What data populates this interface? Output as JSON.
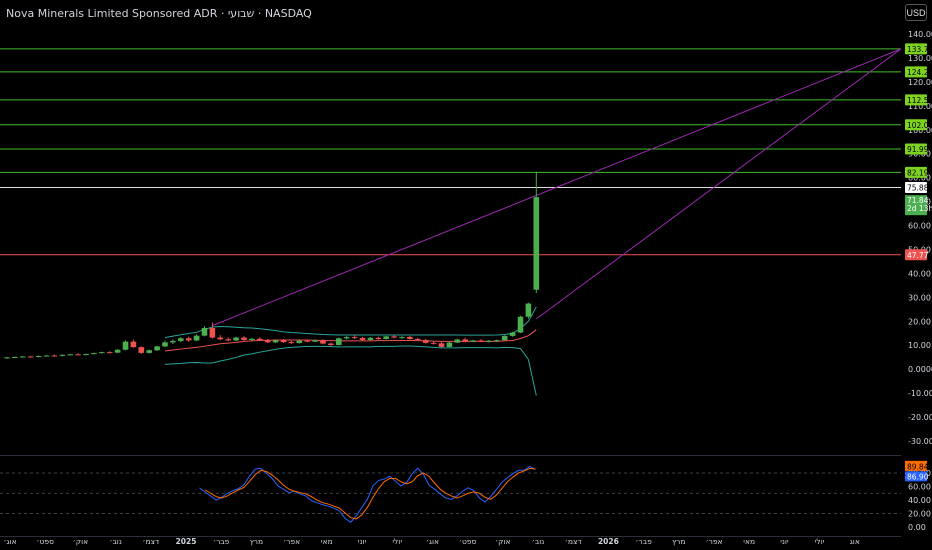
{
  "title": "Nova Minerals Limited Sponsored ADR · שבועי · NASDAQ",
  "currency_button": "USD",
  "colors": {
    "background": "#000000",
    "up": "#4caf50",
    "down": "#ef5350",
    "level_line": "#3fbf2a",
    "level_badge": "#7ed321",
    "red_level": "#ef5350",
    "trendline": "#9c27b0",
    "bb_band": "#26a69a",
    "bb_basis": "#ef5350",
    "stoch_k": "#2962ff",
    "stoch_d": "#ff6d00",
    "grid_text": "#d1d4dc"
  },
  "price_axis": {
    "ticks": [
      "140.00",
      "130.00",
      "120.00",
      "110.00",
      "100.00",
      "90.00",
      "80.00",
      "70.00",
      "60.00",
      "50.00",
      "40.00",
      "30.00",
      "20.00",
      "10.00",
      "0.0000",
      "-10.00",
      "-20.00",
      "-30.00"
    ],
    "tick_values": [
      140,
      130,
      120,
      110,
      100,
      90,
      80,
      70,
      60,
      50,
      40,
      30,
      20,
      10,
      0,
      -10,
      -20,
      -30
    ],
    "ylim": [
      -35,
      146
    ]
  },
  "levels": [
    {
      "label": "133.79",
      "value": 133.79,
      "color": "green"
    },
    {
      "label": "124.20",
      "value": 124.2,
      "color": "green"
    },
    {
      "label": "112.51",
      "value": 112.51,
      "color": "green"
    },
    {
      "label": "102.09",
      "value": 102.09,
      "color": "green"
    },
    {
      "label": "91.99",
      "value": 91.99,
      "color": "green"
    },
    {
      "label": "82.19",
      "value": 82.19,
      "color": "green"
    },
    {
      "label": "75.88",
      "value": 75.88,
      "color": "white"
    },
    {
      "label": "47.77",
      "value": 47.77,
      "color": "red"
    }
  ],
  "last_price": {
    "label": "71.84",
    "countdown": "2d 13h",
    "value": 71.84
  },
  "stoch_axis": {
    "ticks": [
      "80.00",
      "60.00",
      "40.00",
      "20.00",
      "0.00"
    ],
    "tick_values": [
      80,
      60,
      40,
      20,
      0
    ],
    "ylim": [
      -4,
      98
    ],
    "k_label": "89.84",
    "d_label": "86.90"
  },
  "time_axis": [
    "אוג׳",
    "ספט׳",
    "אוק׳",
    "נוב׳",
    "דצמ׳",
    "2025",
    "פבר׳",
    "מרץ",
    "אפר׳",
    "מאי",
    "יוני",
    "יולי",
    "אוג׳",
    "ספט׳",
    "אוק׳",
    "נוב׳",
    "דצמ׳",
    "2026",
    "פבר׳",
    "מרץ",
    "אפר׳",
    "מאי",
    "יוני",
    "יולי",
    "אוג"
  ],
  "chart_data": {
    "type": "candlestick",
    "interval": "weekly",
    "candles": [
      [
        4.6,
        5.1,
        4.4,
        4.9
      ],
      [
        4.9,
        5.3,
        4.7,
        5.1
      ],
      [
        5.1,
        5.5,
        4.9,
        5.3
      ],
      [
        5.3,
        5.6,
        5.0,
        5.2
      ],
      [
        5.2,
        5.7,
        5.0,
        5.5
      ],
      [
        5.5,
        5.9,
        5.3,
        5.7
      ],
      [
        5.7,
        6.1,
        5.4,
        5.6
      ],
      [
        5.6,
        6.2,
        5.4,
        6.0
      ],
      [
        6.0,
        6.4,
        5.8,
        6.2
      ],
      [
        6.2,
        6.6,
        5.7,
        5.9
      ],
      [
        5.9,
        6.5,
        5.7,
        6.3
      ],
      [
        6.3,
        6.9,
        6.1,
        6.7
      ],
      [
        6.7,
        7.3,
        6.5,
        7.1
      ],
      [
        7.1,
        7.5,
        6.6,
        6.9
      ],
      [
        6.9,
        8.4,
        6.7,
        8.1
      ],
      [
        8.1,
        12.0,
        7.9,
        11.5
      ],
      [
        11.5,
        12.4,
        8.9,
        9.2
      ],
      [
        9.2,
        9.6,
        6.4,
        6.8
      ],
      [
        6.8,
        8.2,
        6.5,
        7.9
      ],
      [
        7.9,
        9.8,
        7.6,
        9.5
      ],
      [
        9.5,
        11.8,
        9.2,
        11.2
      ],
      [
        11.2,
        12.4,
        10.5,
        11.8
      ],
      [
        11.8,
        13.4,
        11.3,
        12.9
      ],
      [
        12.9,
        13.6,
        11.4,
        12.0
      ],
      [
        12.0,
        14.5,
        11.7,
        14.0
      ],
      [
        14.0,
        18.0,
        13.7,
        17.2
      ],
      [
        17.2,
        19.5,
        12.8,
        13.2
      ],
      [
        13.2,
        14.2,
        12.0,
        12.5
      ],
      [
        12.5,
        13.3,
        11.7,
        12.0
      ],
      [
        12.0,
        13.6,
        11.7,
        13.2
      ],
      [
        13.2,
        13.8,
        11.9,
        12.2
      ],
      [
        12.2,
        13.1,
        11.6,
        12.7
      ],
      [
        12.7,
        13.3,
        11.8,
        12.1
      ],
      [
        12.1,
        12.6,
        10.9,
        11.2
      ],
      [
        11.2,
        12.4,
        10.9,
        12.0
      ],
      [
        12.0,
        12.6,
        11.0,
        11.3
      ],
      [
        11.3,
        11.9,
        10.6,
        10.9
      ],
      [
        10.9,
        12.2,
        10.7,
        11.9
      ],
      [
        11.9,
        12.3,
        11.2,
        11.5
      ],
      [
        11.5,
        12.4,
        11.3,
        12.1
      ],
      [
        12.1,
        12.5,
        10.4,
        10.7
      ],
      [
        10.7,
        11.2,
        9.8,
        10.1
      ],
      [
        10.1,
        13.2,
        9.9,
        12.9
      ],
      [
        12.9,
        13.8,
        12.4,
        13.4
      ],
      [
        13.4,
        14.2,
        12.6,
        13.0
      ],
      [
        13.0,
        13.5,
        11.9,
        12.2
      ],
      [
        12.2,
        13.4,
        11.9,
        13.1
      ],
      [
        13.1,
        13.5,
        12.3,
        12.6
      ],
      [
        12.6,
        13.9,
        12.4,
        13.7
      ],
      [
        13.7,
        14.3,
        12.9,
        13.2
      ],
      [
        13.2,
        13.7,
        12.6,
        13.5
      ],
      [
        13.5,
        13.9,
        12.3,
        12.6
      ],
      [
        12.6,
        13.1,
        11.9,
        12.2
      ],
      [
        12.2,
        12.6,
        10.7,
        11.0
      ],
      [
        11.0,
        11.6,
        10.3,
        10.8
      ],
      [
        10.8,
        11.4,
        9.0,
        9.3
      ],
      [
        9.3,
        11.4,
        9.1,
        11.1
      ],
      [
        11.1,
        12.7,
        10.9,
        12.4
      ],
      [
        12.4,
        13.2,
        11.2,
        11.5
      ],
      [
        11.5,
        12.3,
        11.3,
        12.0
      ],
      [
        12.0,
        12.5,
        11.3,
        11.6
      ],
      [
        11.6,
        12.2,
        11.1,
        11.9
      ],
      [
        11.9,
        12.4,
        11.4,
        12.1
      ],
      [
        12.1,
        14.2,
        11.9,
        13.9
      ],
      [
        13.9,
        15.6,
        13.6,
        15.3
      ],
      [
        15.3,
        22.3,
        15.1,
        21.9
      ],
      [
        21.9,
        27.8,
        21.1,
        27.4
      ],
      [
        33.2,
        82.5,
        31.8,
        71.84
      ]
    ],
    "bollinger": {
      "upper": [
        null,
        null,
        null,
        null,
        null,
        null,
        null,
        null,
        null,
        null,
        null,
        null,
        null,
        null,
        null,
        null,
        null,
        null,
        null,
        null,
        13.2,
        13.8,
        14.4,
        14.9,
        15.4,
        16.6,
        17.6,
        17.8,
        17.7,
        17.5,
        17.3,
        17.2,
        16.9,
        16.5,
        16.1,
        15.6,
        15.3,
        15.1,
        14.9,
        14.7,
        14.5,
        14.4,
        14.3,
        14.3,
        14.3,
        14.3,
        14.3,
        14.3,
        14.3,
        14.3,
        14.3,
        14.3,
        14.3,
        14.3,
        14.3,
        14.3,
        14.3,
        14.3,
        14.2,
        14.2,
        14.2,
        14.2,
        14.3,
        14.5,
        15.0,
        17.0,
        20.0,
        26.0
      ],
      "basis": [
        null,
        null,
        null,
        null,
        null,
        null,
        null,
        null,
        null,
        null,
        null,
        null,
        null,
        null,
        null,
        null,
        null,
        null,
        null,
        null,
        7.6,
        8.0,
        8.4,
        8.8,
        9.1,
        9.6,
        10.1,
        10.6,
        10.9,
        11.2,
        11.6,
        11.8,
        12.0,
        12.1,
        12.2,
        12.2,
        12.2,
        12.2,
        12.2,
        12.1,
        12.0,
        11.9,
        11.8,
        11.8,
        11.8,
        11.8,
        11.8,
        11.9,
        11.9,
        11.9,
        12.0,
        12.0,
        11.9,
        11.8,
        11.7,
        11.6,
        11.6,
        11.6,
        11.6,
        11.6,
        11.6,
        11.6,
        11.6,
        11.8,
        12.0,
        12.8,
        14.0,
        16.5
      ],
      "lower": [
        null,
        null,
        null,
        null,
        null,
        null,
        null,
        null,
        null,
        null,
        null,
        null,
        null,
        null,
        null,
        null,
        null,
        null,
        null,
        null,
        2.0,
        2.2,
        2.4,
        2.7,
        2.8,
        2.6,
        2.6,
        3.4,
        4.1,
        4.9,
        5.9,
        6.4,
        7.1,
        7.7,
        8.3,
        8.8,
        9.1,
        9.3,
        9.5,
        9.5,
        9.5,
        9.4,
        9.3,
        9.3,
        9.3,
        9.3,
        9.3,
        9.5,
        9.5,
        9.5,
        9.7,
        9.7,
        9.5,
        9.3,
        9.1,
        8.9,
        8.9,
        8.9,
        9.0,
        9.0,
        9.0,
        9.0,
        8.9,
        9.1,
        9.0,
        8.6,
        4.0,
        -11.0
      ]
    },
    "trendlines": [
      {
        "from": [
          26,
          18.2
        ],
        "to": [
          "extends",
          133.79
        ]
      },
      {
        "from": [
          67,
          21.0
        ],
        "to": [
          "extends",
          133.79
        ]
      }
    ],
    "stochastic": {
      "k": [
        null,
        null,
        null,
        null,
        null,
        null,
        null,
        null,
        null,
        null,
        null,
        null,
        null,
        null,
        null,
        null,
        null,
        null,
        null,
        58,
        52,
        46,
        40,
        44,
        50,
        54,
        57,
        63,
        76,
        86,
        87,
        79,
        72,
        61,
        56,
        51,
        53,
        49,
        46,
        39,
        36,
        33,
        31,
        28,
        24,
        13,
        7,
        16,
        29,
        41,
        61,
        69,
        71,
        75,
        68,
        61,
        66,
        79,
        87,
        78,
        62,
        56,
        49,
        43,
        41,
        46,
        53,
        58,
        54,
        43,
        37,
        45,
        55,
        66,
        73,
        79,
        84,
        84,
        89.84,
        85
      ],
      "d": [
        null,
        null,
        null,
        null,
        null,
        null,
        null,
        null,
        null,
        null,
        null,
        null,
        null,
        null,
        null,
        null,
        null,
        null,
        null,
        null,
        55,
        50,
        45,
        43,
        46,
        51,
        55,
        59,
        68,
        78,
        84,
        82,
        77,
        70,
        62,
        56,
        53,
        51,
        49,
        45,
        40,
        36,
        34,
        31,
        28,
        21,
        14,
        12,
        18,
        29,
        44,
        57,
        67,
        72,
        72,
        67,
        64,
        67,
        76,
        80,
        75,
        65,
        56,
        50,
        46,
        43,
        46,
        50,
        52,
        50,
        44,
        41,
        47,
        57,
        67,
        74,
        80,
        83,
        86.9,
        86
      ]
    }
  }
}
